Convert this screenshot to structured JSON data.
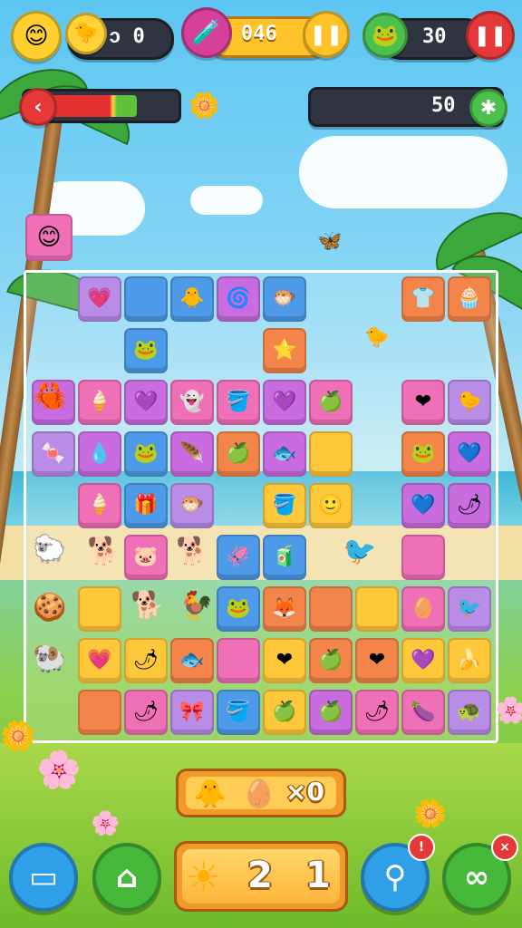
{
  "hud": {
    "left_counter": "ↄ 0",
    "center_score": "046",
    "right_counter": "30",
    "goal_value": "50",
    "progress_fraction": 0.75
  },
  "board": {
    "tiles": [
      {
        "c": "#b98ce8",
        "g": "💗"
      },
      {
        "c": "#4d9be8",
        "g": ""
      },
      {
        "c": "#4d9be8",
        "g": "🐥"
      },
      {
        "c": "#c86ce0",
        "g": "🌀"
      },
      {
        "c": "#4d9be8",
        "g": "🐡"
      },
      {
        "c": "#f4854a",
        "g": "👕"
      },
      {
        "c": "#f4854a",
        "g": "🧁"
      },
      {
        "c": "#4d9be8",
        "g": "🐸"
      },
      {
        "c": "#f4854a",
        "g": "⭐"
      },
      {
        "c": "#c86ce0",
        "g": "🦀"
      },
      {
        "c": "#f070b8",
        "g": "🍦"
      },
      {
        "c": "#c86ce0",
        "g": "💜"
      },
      {
        "c": "#f070b8",
        "g": "👻"
      },
      {
        "c": "#f070b8",
        "g": "🪣"
      },
      {
        "c": "#c86ce0",
        "g": "💜"
      },
      {
        "c": "#f070b8",
        "g": "🍏"
      },
      {
        "c": "#f070b8",
        "g": "❤"
      },
      {
        "c": "#b98ce8",
        "g": "🐤"
      },
      {
        "c": "#b98ce8",
        "g": "🍬"
      },
      {
        "c": "#c86ce0",
        "g": "💧"
      },
      {
        "c": "#4d9be8",
        "g": "🐸"
      },
      {
        "c": "#c86ce0",
        "g": "🪶"
      },
      {
        "c": "#f4854a",
        "g": "🍏"
      },
      {
        "c": "#c86ce0",
        "g": "🐟"
      },
      {
        "c": "#ffc83a",
        "g": ""
      },
      {
        "c": "#f4854a",
        "g": "🐸"
      },
      {
        "c": "#c86ce0",
        "g": "💙"
      },
      {
        "c": "#f070b8",
        "g": "🍦"
      },
      {
        "c": "#4d9be8",
        "g": "🎁"
      },
      {
        "c": "#b98ce8",
        "g": "🐡"
      },
      {
        "c": "#ffc83a",
        "g": "🪣"
      },
      {
        "c": "#ffc83a",
        "g": "🙂"
      },
      {
        "c": "#c86ce0",
        "g": "💙"
      },
      {
        "c": "#c86ce0",
        "g": "🌶"
      },
      {
        "c": "#f070b8",
        "g": "🐷"
      },
      {
        "c": "#4d9be8",
        "g": "🦑"
      },
      {
        "c": "#4d9be8",
        "g": "🧃"
      },
      {
        "c": "#f070b8",
        "g": ""
      },
      {
        "c": "#ffc83a",
        "g": ""
      },
      {
        "c": "#4d9be8",
        "g": "🐸"
      },
      {
        "c": "#f4854a",
        "g": "🦊"
      },
      {
        "c": "#f4854a",
        "g": ""
      },
      {
        "c": "#ffc83a",
        "g": ""
      },
      {
        "c": "#f070b8",
        "g": "🥚"
      },
      {
        "c": "#b98ce8",
        "g": "🐦"
      },
      {
        "c": "#ffc83a",
        "g": "💗"
      },
      {
        "c": "#ffc83a",
        "g": "🌶"
      },
      {
        "c": "#f4854a",
        "g": "🐟"
      },
      {
        "c": "#f070b8",
        "g": ""
      },
      {
        "c": "#ffc83a",
        "g": "❤"
      },
      {
        "c": "#f4854a",
        "g": "🍏"
      },
      {
        "c": "#f4854a",
        "g": "❤"
      },
      {
        "c": "#ffc83a",
        "g": "💜"
      },
      {
        "c": "#ffc83a",
        "g": "🍌"
      },
      {
        "c": "#f4854a",
        "g": ""
      },
      {
        "c": "#f070b8",
        "g": "🌶"
      },
      {
        "c": "#b98ce8",
        "g": "🎀"
      },
      {
        "c": "#4d9be8",
        "g": "🪣"
      },
      {
        "c": "#ffc83a",
        "g": "🍏"
      },
      {
        "c": "#c86ce0",
        "g": "🍏"
      },
      {
        "c": "#f070b8",
        "g": "🌶"
      },
      {
        "c": "#f070b8",
        "g": "🍆"
      },
      {
        "c": "#b98ce8",
        "g": "🐢"
      }
    ]
  },
  "combo": {
    "count": "×0"
  },
  "moves": {
    "left_digit": "2",
    "right_digit": "1"
  },
  "icons": [
    "smiley-face-icon",
    "duck-icon",
    "potion-icon",
    "pause-icon",
    "frog-icon",
    "stop-icon",
    "back-arrow-icon",
    "star-flower-icon",
    "plus-icon",
    "chat-icon",
    "home-icon",
    "sun-icon",
    "search-icon",
    "share-icon"
  ]
}
